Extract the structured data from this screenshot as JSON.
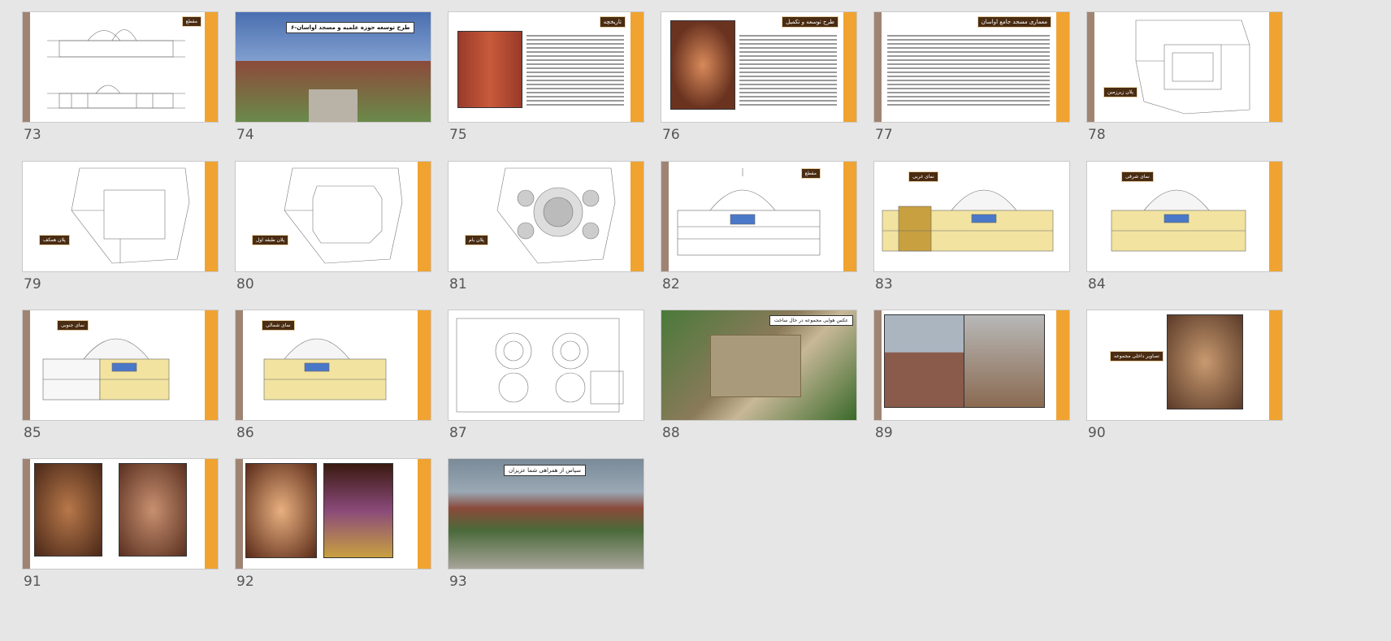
{
  "slides": [
    {
      "number": "73",
      "label": "مقطع"
    },
    {
      "number": "74",
      "label": "۶-طرح توسعه حوزه علمیه و مسجد اواسان"
    },
    {
      "number": "75",
      "label": "تاریخچه"
    },
    {
      "number": "76",
      "label": "طرح توسعه و تکمیل"
    },
    {
      "number": "77",
      "label": "معماری مسجد جامع اواسان"
    },
    {
      "number": "78",
      "label": "پلان زیرزمین"
    },
    {
      "number": "79",
      "label": "پلان همکف"
    },
    {
      "number": "80",
      "label": "پلان طبقه اول"
    },
    {
      "number": "81",
      "label": "پلان بام"
    },
    {
      "number": "82",
      "label": "مقطع"
    },
    {
      "number": "83",
      "label": "نمای غربی"
    },
    {
      "number": "84",
      "label": "نمای شرقی"
    },
    {
      "number": "85",
      "label": "نمای جنوبی"
    },
    {
      "number": "86",
      "label": "نمای شمالی"
    },
    {
      "number": "87",
      "label": ""
    },
    {
      "number": "88",
      "label": "عکس هوایی مجموعه در حال ساخت"
    },
    {
      "number": "89",
      "label": ""
    },
    {
      "number": "90",
      "label": "تصاویر داخلی مجموعه"
    },
    {
      "number": "91",
      "label": ""
    },
    {
      "number": "92",
      "label": ""
    },
    {
      "number": "93",
      "label": "سپاس از همراهی شما عزیزان"
    }
  ],
  "colors": {
    "left_bar": "#a08473",
    "right_bar": "#f0a330",
    "label_bg": "#4a2c12",
    "background": "#e6e6e6"
  }
}
